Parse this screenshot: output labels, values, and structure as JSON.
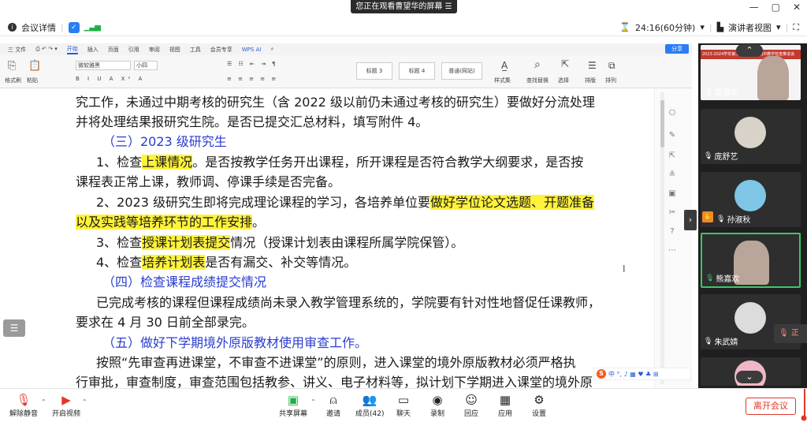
{
  "banner": {
    "text": "您正在观看曹望华的屏幕 ☰"
  },
  "window": {
    "minimize": "—",
    "restore": "▢",
    "close": "✕"
  },
  "meeting_bar": {
    "details_label": "会议详情",
    "timer": "24:16(60分钟)",
    "view_label": "演讲者视图"
  },
  "wps": {
    "menu": [
      "三 文件",
      "开始",
      "插入",
      "页面",
      "引用",
      "审阅",
      "视图",
      "工具",
      "会员专享",
      "WPS AI"
    ],
    "active_tab": "开始",
    "font_name": "微软雅黑",
    "font_size": "小四",
    "styles": [
      "标题 3",
      "标题 4",
      "普通(网站)"
    ],
    "share_label": "分享",
    "ribbon_labels": [
      "格式刷",
      "粘贴",
      "样式集",
      "查找替换",
      "选择",
      "排版",
      "排列"
    ]
  },
  "document": {
    "lines": [
      [
        "究工作，未通过中期考核的研究生（含 2022 级以前仍未通过考核的研究生）要做好分流处理"
      ],
      [
        "并将处理结果报研究生院。是否已提交汇总材料，填写附件 4。"
      ],
      [
        "（三）2023 级研究生"
      ],
      [
        "1、检查",
        "上课情况",
        "。是否按教学任务开出课程，所开课程是否符合教学大纲要求，是否按"
      ],
      [
        "课程表正常上课，教师调、停课手续是否完备。"
      ],
      [
        "2、2023 级研究生即将完成理论课程的学习，各培养单位要",
        "做好学位论文选题、开题准备"
      ],
      [
        "以及实践等培养环节的工作安排",
        "。"
      ],
      [
        "3、检查",
        "授课计划表提交",
        "情况（授课计划表由课程所属学院保管）。"
      ],
      [
        "4、检查",
        "培养计划表",
        "是否有漏交、补交等情况。"
      ],
      [
        "（四）检查课程成绩提交情况"
      ],
      [
        "已完成考核的课程但课程成绩尚未录入教学管理系统的，学院要有针对性地督促任课教师，"
      ],
      [
        "要求在 4 月 30 日前全部录完。"
      ],
      [
        "（五）做好下学期境外原版教材使用审查工作。"
      ],
      [
        "按照“先审查再进课堂，不审查不进课堂”的原则，进入课堂的境外原版教材必须严格执"
      ],
      [
        "行审批，审查制度，审查范围包括教参、讲义、电子材料等，拟计划下学期进入课堂的境外原"
      ]
    ]
  },
  "ime_bar": {
    "text": "中 °, ♪ ▦ ♥ ♣ ⊞"
  },
  "participants": [
    {
      "name": "曹望华",
      "type": "slide",
      "slide_title": "2023-2024学年第二学期研究生期中教学检查推进会"
    },
    {
      "name": "庞舒艺",
      "type": "avatar"
    },
    {
      "name": "孙淑秋",
      "type": "avatar"
    },
    {
      "name": "熊嘉欢",
      "type": "camera"
    },
    {
      "name": "朱武婧",
      "type": "avatar"
    }
  ],
  "side_tab": "正",
  "toolbar": {
    "unmute": "解除静音",
    "start_video": "开启视频",
    "share_screen": "共享屏幕",
    "invite": "邀请",
    "members": "成员(42)",
    "chat": "聊天",
    "record": "录制",
    "react": "回应",
    "apps": "应用",
    "settings": "设置",
    "leave": "离开会议"
  },
  "colors": {
    "accent": "#2a7df5",
    "highlight": "#fff23a",
    "heading_blue": "#2a3ccf",
    "leave_red": "#e0372a",
    "active_green": "#3ec46d"
  }
}
